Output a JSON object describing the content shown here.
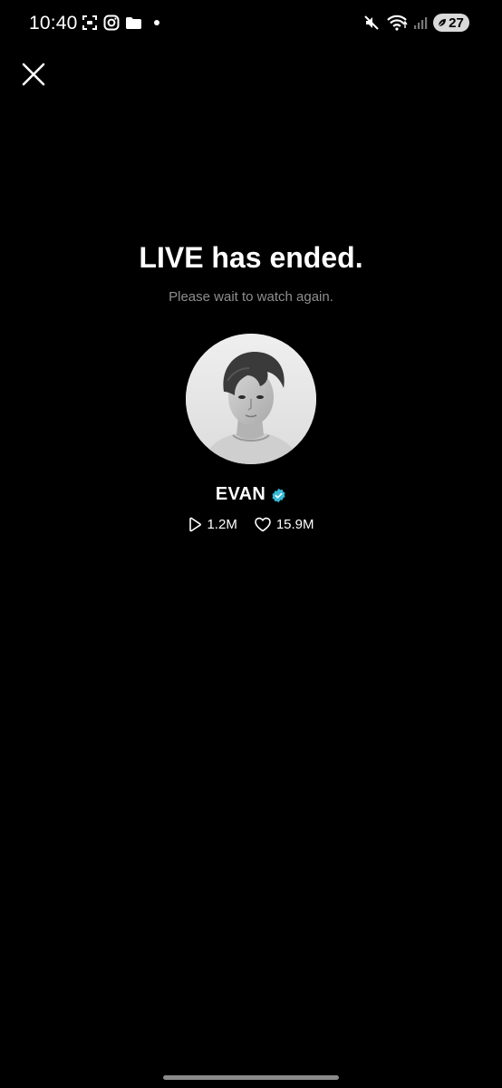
{
  "status_bar": {
    "time": "10:40",
    "battery_level": "27",
    "left_icons": [
      "screenshot-icon",
      "instagram-icon",
      "folder-icon",
      "notification-dot-icon"
    ],
    "right_icons": [
      "mute-icon",
      "wifi-icon",
      "signal-icon",
      "battery-icon"
    ]
  },
  "header": {
    "close_icon": "close-icon"
  },
  "live_ended": {
    "title": "LIVE has ended.",
    "subtitle": "Please wait to watch again."
  },
  "creator": {
    "name": "EVAN",
    "verified": true,
    "verified_color": "#35b9d6",
    "plays": "1.2M",
    "likes": "15.9M"
  },
  "colors": {
    "background": "#000000",
    "subtitle": "#8e8e8e"
  }
}
